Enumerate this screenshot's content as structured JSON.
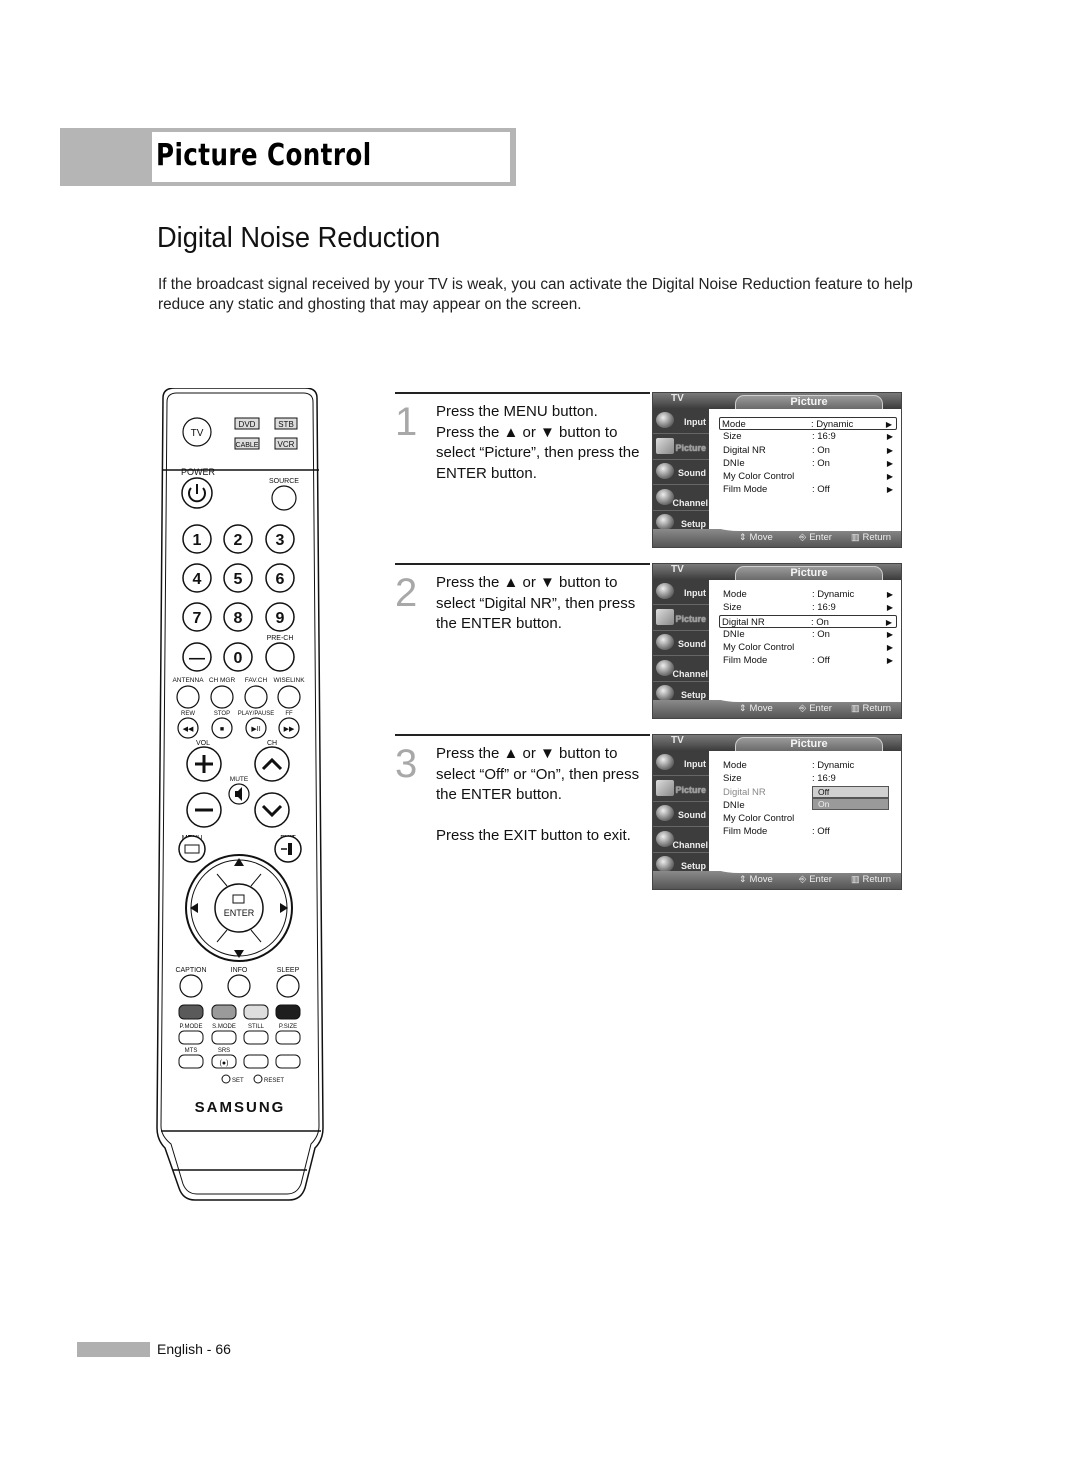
{
  "header": {
    "title": "Picture Control"
  },
  "section": {
    "title": "Digital Noise Reduction",
    "intro": "If the broadcast signal received by your TV is weak, you can activate the Digital Noise Reduction feature to help reduce any static and ghosting that may appear on the screen."
  },
  "remote": {
    "mode_buttons": [
      "TV",
      "DVD",
      "STB",
      "CABLE",
      "VCR"
    ],
    "power_label": "POWER",
    "source_label": "SOURCE",
    "number_buttons": [
      "1",
      "2",
      "3",
      "4",
      "5",
      "6",
      "7",
      "8",
      "9",
      "—",
      "0",
      ""
    ],
    "prech_label": "PRE-CH",
    "function_labels": [
      "ANTENNA",
      "CH MGR",
      "FAV.CH",
      "WISELINK"
    ],
    "transport_labels": [
      "REW",
      "STOP",
      "PLAY/PAUSE",
      "FF"
    ],
    "vol_label": "VOL",
    "ch_label": "CH",
    "mute_label": "MUTE",
    "menu_label": "MENU",
    "exit_label": "EXIT",
    "enter_label": "ENTER",
    "lower_labels": [
      "CAPTION",
      "INFO",
      "SLEEP"
    ],
    "color_labels": [
      "P.MODE",
      "S.MODE",
      "STILL",
      "P.SIZE"
    ],
    "color_button_fills": [
      "#5a5a5a",
      "#9a9a9a",
      "#dedede",
      "#1e1e1e"
    ],
    "row2_labels": [
      "MTS",
      "SRS"
    ],
    "srs_symbol": "(●)",
    "set_label": "SET",
    "reset_label": "RESET",
    "brand": "SAMSUNG"
  },
  "steps": [
    {
      "number": "1",
      "lines": [
        "Press the MENU button.",
        "Press the ▲ or ▼ button to select “Picture”, then press the ENTER button."
      ]
    },
    {
      "number": "2",
      "lines": [
        "Press the ▲ or ▼ button to select “Digital NR”, then press the ENTER button."
      ]
    },
    {
      "number": "3",
      "lines": [
        "Press the ▲ or ▼ button to select “Off” or “On”, then press the ENTER button.",
        "Press the EXIT button to exit."
      ]
    }
  ],
  "osd": {
    "source_label": "TV",
    "menu_title": "Picture",
    "sidebar": [
      "Input",
      "Picture",
      "Sound",
      "Channel",
      "Setup"
    ],
    "items": [
      {
        "key": "Mode",
        "value": ": Dynamic"
      },
      {
        "key": "Size",
        "value": ": 16:9"
      },
      {
        "key": "Digital NR",
        "value": ": On"
      },
      {
        "key": "DNIe",
        "value": ": On"
      },
      {
        "key": "My Color Control",
        "value": ""
      },
      {
        "key": "Film Mode",
        "value": ": Off"
      }
    ],
    "dropdown_options": [
      "Off",
      "On"
    ],
    "help": {
      "move": "Move",
      "enter": "Enter",
      "return": "Return"
    }
  },
  "footer": {
    "page_label": "English - 66"
  }
}
